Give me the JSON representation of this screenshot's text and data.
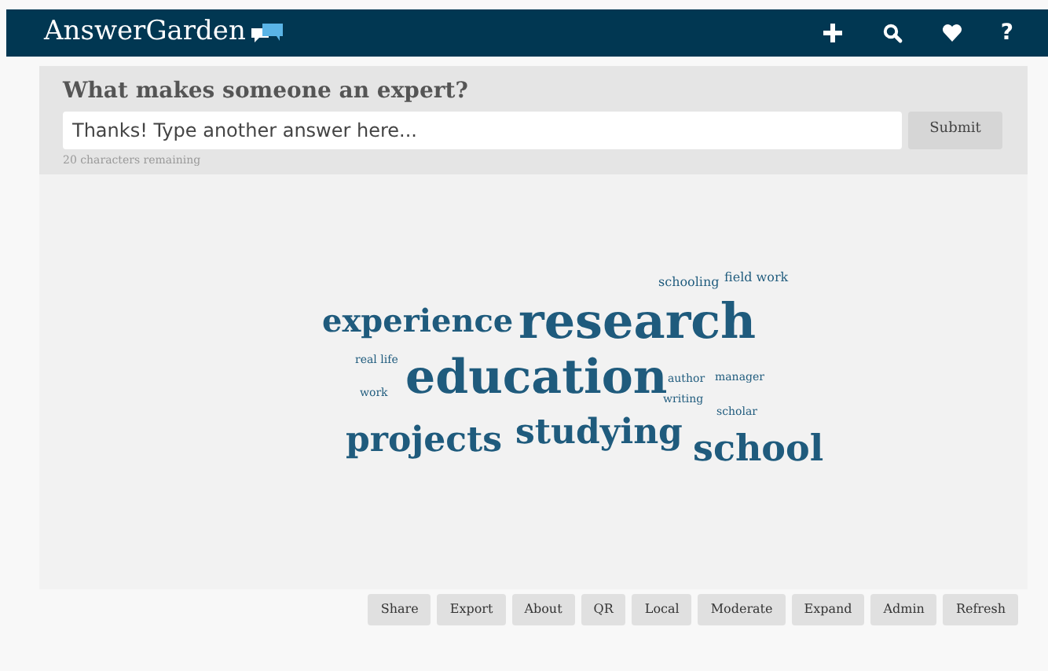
{
  "navbar": {
    "brand": "AnswerGarden",
    "help": "?"
  },
  "question": {
    "title": "What makes someone an expert?",
    "placeholder": "Thanks! Type another answer here...",
    "submit": "Submit",
    "remaining": "20 characters remaining"
  },
  "cloud": [
    {
      "text": "schooling"
    },
    {
      "text": "field work"
    },
    {
      "text": "experience"
    },
    {
      "text": "research"
    },
    {
      "text": "real life"
    },
    {
      "text": "education"
    },
    {
      "text": "author"
    },
    {
      "text": "manager"
    },
    {
      "text": "work"
    },
    {
      "text": "writing"
    },
    {
      "text": "scholar"
    },
    {
      "text": "projects"
    },
    {
      "text": "studying"
    },
    {
      "text": "school"
    }
  ],
  "buttons": [
    "Share",
    "Export",
    "About",
    "QR",
    "Local",
    "Moderate",
    "Expand",
    "Admin",
    "Refresh"
  ]
}
